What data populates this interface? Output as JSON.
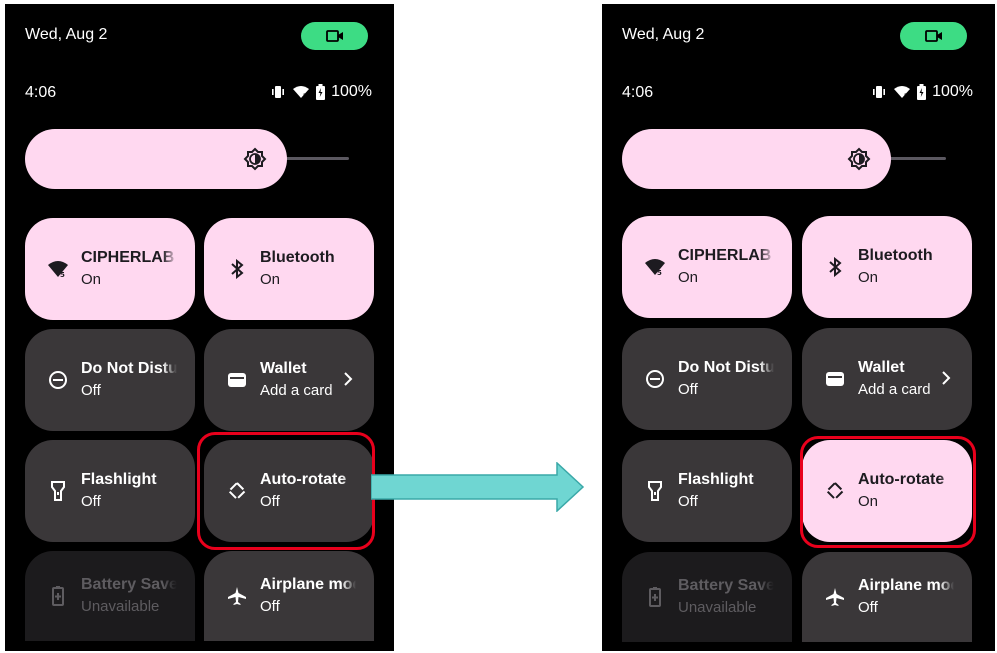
{
  "left": {
    "date": "Wed, Aug 2",
    "time": "4:06",
    "battery": "100%",
    "brightness_level": 0.81,
    "tiles": [
      {
        "label": "CIPHERLAB",
        "state": "On"
      },
      {
        "label": "Bluetooth",
        "state": "On"
      },
      {
        "label": "Do Not Disturb",
        "state": "Off"
      },
      {
        "label": "Wallet",
        "state": "Add a card"
      },
      {
        "label": "Flashlight",
        "state": "Off"
      },
      {
        "label": "Auto-rotate",
        "state": "Off"
      },
      {
        "label": "Battery Saver",
        "state": "Unavailable"
      },
      {
        "label": "Airplane mode",
        "state": "Off"
      }
    ]
  },
  "right": {
    "date": "Wed, Aug 2",
    "time": "4:06",
    "battery": "100%",
    "brightness_level": 0.83,
    "tiles": [
      {
        "label": "CIPHERLAB",
        "state": "On"
      },
      {
        "label": "Bluetooth",
        "state": "On"
      },
      {
        "label": "Do Not Disturb",
        "state": "Off"
      },
      {
        "label": "Wallet",
        "state": "Add a card"
      },
      {
        "label": "Flashlight",
        "state": "Off"
      },
      {
        "label": "Auto-rotate",
        "state": "On"
      },
      {
        "label": "Battery Saver",
        "state": "Unavailable"
      },
      {
        "label": "Airplane mode",
        "state": "Off"
      }
    ]
  },
  "icons": {
    "camera": "video-camera-icon",
    "vibrate": "vibrate-icon",
    "wifi": "wifi-icon",
    "battery": "battery-icon",
    "brightness": "brightness-icon",
    "bluetooth": "bluetooth-icon",
    "dnd": "do-not-disturb-icon",
    "wallet": "wallet-icon",
    "flashlight": "flashlight-icon",
    "rotate": "auto-rotate-icon",
    "battery_saver": "battery-saver-icon",
    "airplane": "airplane-icon"
  },
  "colors": {
    "tile_on": "#ffd8f0",
    "tile_off": "#3a3739",
    "camera_chip": "#3ddc84",
    "highlight": "#e8001c",
    "arrow": "#6fd6d2"
  }
}
